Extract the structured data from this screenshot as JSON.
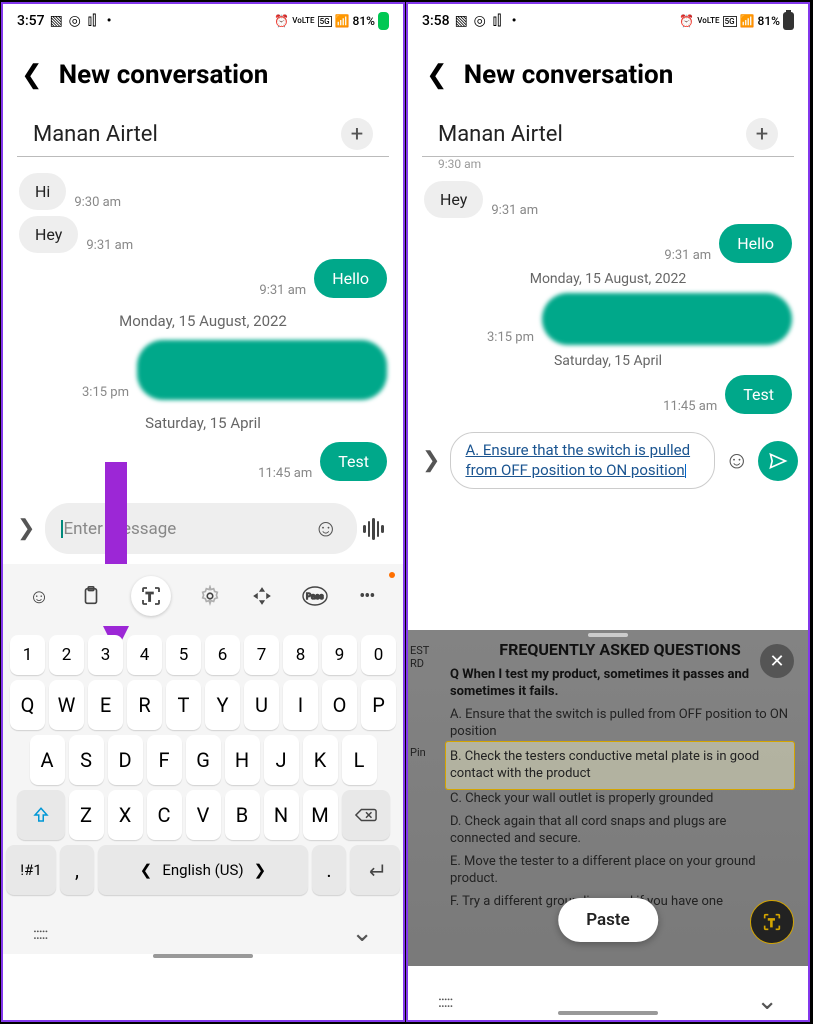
{
  "left": {
    "status": {
      "time": "3:57",
      "battery": "81%",
      "indicators": [
        "pic",
        "ig",
        "chart",
        "dot",
        "alarm",
        "volte",
        "5g",
        "signal"
      ]
    },
    "title": "New conversation",
    "recipient": "Manan Airtel",
    "messages": {
      "m1": {
        "text": "Hi",
        "time": "9:30 am"
      },
      "m2": {
        "text": "Hey",
        "time": "9:31 am"
      },
      "m3": {
        "text": "Hello",
        "time": "9:31 am"
      },
      "date1": "Monday, 15 August, 2022",
      "m4": {
        "time": "3:15 pm"
      },
      "date2": "Saturday, 15 April",
      "m5": {
        "text": "Test",
        "time": "11:45 am"
      }
    },
    "input_placeholder": "Enter message",
    "keyboard": {
      "row_num": [
        "1",
        "2",
        "3",
        "4",
        "5",
        "6",
        "7",
        "8",
        "9",
        "0"
      ],
      "row1": [
        "Q",
        "W",
        "E",
        "R",
        "T",
        "Y",
        "U",
        "I",
        "O",
        "P"
      ],
      "row2": [
        "A",
        "S",
        "D",
        "F",
        "G",
        "H",
        "J",
        "K",
        "L"
      ],
      "row3": [
        "Z",
        "X",
        "C",
        "V",
        "B",
        "N",
        "M"
      ],
      "lang": "English (US)",
      "sym_label": "!#1"
    }
  },
  "right": {
    "status": {
      "time": "3:58",
      "battery": "81%",
      "indicators": [
        "pic",
        "ig",
        "chart",
        "dot",
        "alarm",
        "volte",
        "5g",
        "signal"
      ]
    },
    "title": "New conversation",
    "recipient": "Manan Airtel",
    "prev_time": "9:30 am",
    "messages": {
      "m2": {
        "text": "Hey",
        "time": "9:31 am"
      },
      "m3": {
        "text": "Hello",
        "time": "9:31 am"
      },
      "date1": "Monday, 15 August, 2022",
      "m4": {
        "time": "3:15 pm"
      },
      "date2": "Saturday, 15 April",
      "m5": {
        "text": "Test",
        "time": "11:45 am"
      }
    },
    "input_text": "A. Ensure that the switch is pulled from OFF position to ON position",
    "ocr": {
      "side_test": "EST",
      "side_rd": "RD",
      "side_pin": "Pin",
      "title": "FREQUENTLY ASKED QUESTIONS",
      "q": "Q When I test my product, sometimes it passes and sometimes it fails.",
      "a": "A. Ensure that the switch is pulled from OFF position to ON position",
      "b": "B. Check the testers conductive metal plate is in good contact with the product",
      "c": "C. Check your wall outlet is properly grounded",
      "d": "D. Check again that all cord snaps and plugs are connected and secure.",
      "e": "E. Move the tester to a different place on your ground product.",
      "f": "F. Try a different grounding cord if you have one"
    },
    "paste_label": "Paste"
  }
}
